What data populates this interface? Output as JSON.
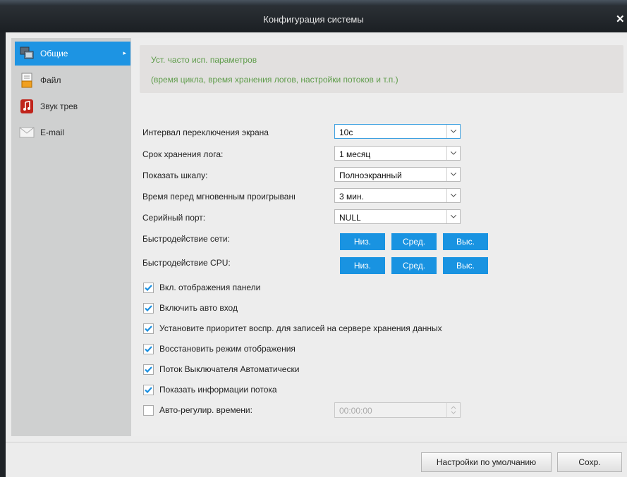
{
  "window": {
    "title": "Конфигурация системы",
    "close_glyph": "✕"
  },
  "sidebar": {
    "items": [
      {
        "label": "Общие",
        "icon": "monitor-icon",
        "active": true,
        "arrow": "▸"
      },
      {
        "label": "Файл",
        "icon": "file-icon"
      },
      {
        "label": "Звук трев",
        "icon": "alarm-sound-icon"
      },
      {
        "label": "E-mail",
        "icon": "mail-icon"
      }
    ]
  },
  "info": {
    "line1": "Уст. часто исп. параметров",
    "line2": "(время цикла,  время хранения логов, настройки потоков и т.п.)"
  },
  "settings": [
    {
      "label": "Интервал переключения экрана",
      "value": "10с"
    },
    {
      "label": "Срок хранения лога:",
      "value": "1 месяц"
    },
    {
      "label": "Показать шкалу:",
      "value": "Полноэкранный"
    },
    {
      "label": "Время перед мгновенным проигрыванием",
      "value": "3 мин."
    },
    {
      "label": "Серийный порт:",
      "value": "NULL"
    }
  ],
  "performance": {
    "network": {
      "label": "Быстродействие сети:",
      "buttons": [
        "Низ.",
        "Сред.",
        "Выс."
      ]
    },
    "cpu": {
      "label": "Быстродействие CPU:",
      "buttons": [
        "Низ.",
        "Сред.",
        "Выс."
      ]
    }
  },
  "checkboxes": [
    {
      "label": "Вкл. отображения панели",
      "checked": true
    },
    {
      "label": "Включить авто вход",
      "checked": true
    },
    {
      "label": "Установите приоритет воспр. для записей на сервере хранения данных",
      "checked": true
    },
    {
      "label": "Восстановить режим отображения",
      "checked": true
    },
    {
      "label": "Поток Выключателя Автоматически",
      "checked": true
    },
    {
      "label": "Показать информации потока",
      "checked": true
    },
    {
      "label": "Авто-регулир. времени:",
      "checked": false
    }
  ],
  "auto_time": {
    "value": "00:00:00",
    "disabled": true
  },
  "footer": {
    "defaults_label": "Настройки по умолчанию",
    "save_label": "Сохр."
  },
  "colors": {
    "accent": "#1993e1",
    "info_text": "#5e9c4a",
    "title_bar": "#1f2327"
  }
}
